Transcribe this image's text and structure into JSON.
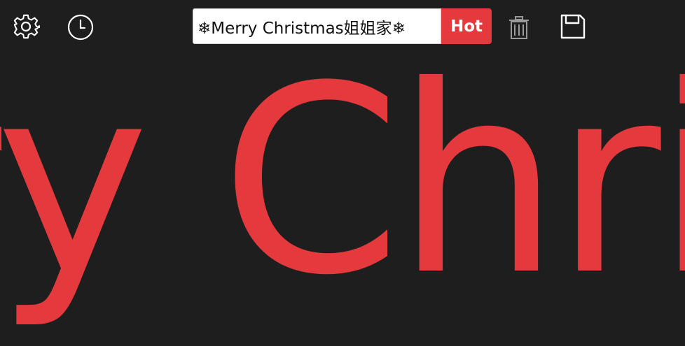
{
  "toolbar": {
    "settings_icon": "gear-icon",
    "history_icon": "clock-icon",
    "delete_icon": "trash-icon",
    "save_icon": "floppy-disk-icon",
    "text_input_value": "❄Merry Christmas姐姐家❄",
    "hot_label": "Hot"
  },
  "display": {
    "marquee_text": "ry Christmas",
    "text_color": "#e53a3d",
    "background_color": "#1f1e1f"
  }
}
